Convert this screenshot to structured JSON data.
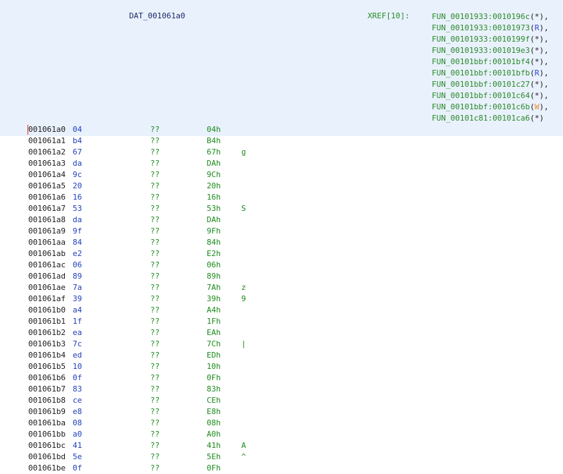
{
  "header": {
    "label": "DAT_001061a0",
    "xref_label": "XREF[10]:",
    "xrefs": [
      {
        "fn": "FUN_00101933:0010196c",
        "ref": "*",
        "sep": ","
      },
      {
        "fn": "FUN_00101933:00101973",
        "ref": "R",
        "sep": ","
      },
      {
        "fn": "FUN_00101933:0010199f",
        "ref": "*",
        "sep": ","
      },
      {
        "fn": "FUN_00101933:001019e3",
        "ref": "*",
        "sep": ","
      },
      {
        "fn": "FUN_00101bbf:00101bf4",
        "ref": "*",
        "sep": ","
      },
      {
        "fn": "FUN_00101bbf:00101bfb",
        "ref": "R",
        "sep": ","
      },
      {
        "fn": "FUN_00101bbf:00101c27",
        "ref": "*",
        "sep": ","
      },
      {
        "fn": "FUN_00101bbf:00101c64",
        "ref": "*",
        "sep": ","
      },
      {
        "fn": "FUN_00101bbf:00101c6b",
        "ref": "W",
        "sep": ","
      },
      {
        "fn": "FUN_00101c81:00101ca6",
        "ref": "*",
        "sep": ""
      }
    ]
  },
  "listing": [
    {
      "addr": "001061a0",
      "byte": "04",
      "type": "??",
      "val": "04h",
      "chr": ""
    },
    {
      "addr": "001061a1",
      "byte": "b4",
      "type": "??",
      "val": "B4h",
      "chr": ""
    },
    {
      "addr": "001061a2",
      "byte": "67",
      "type": "??",
      "val": "67h",
      "chr": "g"
    },
    {
      "addr": "001061a3",
      "byte": "da",
      "type": "??",
      "val": "DAh",
      "chr": ""
    },
    {
      "addr": "001061a4",
      "byte": "9c",
      "type": "??",
      "val": "9Ch",
      "chr": ""
    },
    {
      "addr": "001061a5",
      "byte": "20",
      "type": "??",
      "val": "20h",
      "chr": ""
    },
    {
      "addr": "001061a6",
      "byte": "16",
      "type": "??",
      "val": "16h",
      "chr": ""
    },
    {
      "addr": "001061a7",
      "byte": "53",
      "type": "??",
      "val": "53h",
      "chr": "S"
    },
    {
      "addr": "001061a8",
      "byte": "da",
      "type": "??",
      "val": "DAh",
      "chr": ""
    },
    {
      "addr": "001061a9",
      "byte": "9f",
      "type": "??",
      "val": "9Fh",
      "chr": ""
    },
    {
      "addr": "001061aa",
      "byte": "84",
      "type": "??",
      "val": "84h",
      "chr": ""
    },
    {
      "addr": "001061ab",
      "byte": "e2",
      "type": "??",
      "val": "E2h",
      "chr": ""
    },
    {
      "addr": "001061ac",
      "byte": "06",
      "type": "??",
      "val": "06h",
      "chr": ""
    },
    {
      "addr": "001061ad",
      "byte": "89",
      "type": "??",
      "val": "89h",
      "chr": ""
    },
    {
      "addr": "001061ae",
      "byte": "7a",
      "type": "??",
      "val": "7Ah",
      "chr": "z"
    },
    {
      "addr": "001061af",
      "byte": "39",
      "type": "??",
      "val": "39h",
      "chr": "9"
    },
    {
      "addr": "001061b0",
      "byte": "a4",
      "type": "??",
      "val": "A4h",
      "chr": ""
    },
    {
      "addr": "001061b1",
      "byte": "1f",
      "type": "??",
      "val": "1Fh",
      "chr": ""
    },
    {
      "addr": "001061b2",
      "byte": "ea",
      "type": "??",
      "val": "EAh",
      "chr": ""
    },
    {
      "addr": "001061b3",
      "byte": "7c",
      "type": "??",
      "val": "7Ch",
      "chr": "|"
    },
    {
      "addr": "001061b4",
      "byte": "ed",
      "type": "??",
      "val": "EDh",
      "chr": ""
    },
    {
      "addr": "001061b5",
      "byte": "10",
      "type": "??",
      "val": "10h",
      "chr": ""
    },
    {
      "addr": "001061b6",
      "byte": "0f",
      "type": "??",
      "val": "0Fh",
      "chr": ""
    },
    {
      "addr": "001061b7",
      "byte": "83",
      "type": "??",
      "val": "83h",
      "chr": ""
    },
    {
      "addr": "001061b8",
      "byte": "ce",
      "type": "??",
      "val": "CEh",
      "chr": ""
    },
    {
      "addr": "001061b9",
      "byte": "e8",
      "type": "??",
      "val": "E8h",
      "chr": ""
    },
    {
      "addr": "001061ba",
      "byte": "08",
      "type": "??",
      "val": "08h",
      "chr": ""
    },
    {
      "addr": "001061bb",
      "byte": "a0",
      "type": "??",
      "val": "A0h",
      "chr": ""
    },
    {
      "addr": "001061bc",
      "byte": "41",
      "type": "??",
      "val": "41h",
      "chr": "A"
    },
    {
      "addr": "001061bd",
      "byte": "5e",
      "type": "??",
      "val": "5Eh",
      "chr": "^"
    },
    {
      "addr": "001061be",
      "byte": "0f",
      "type": "??",
      "val": "0Fh",
      "chr": ""
    }
  ]
}
